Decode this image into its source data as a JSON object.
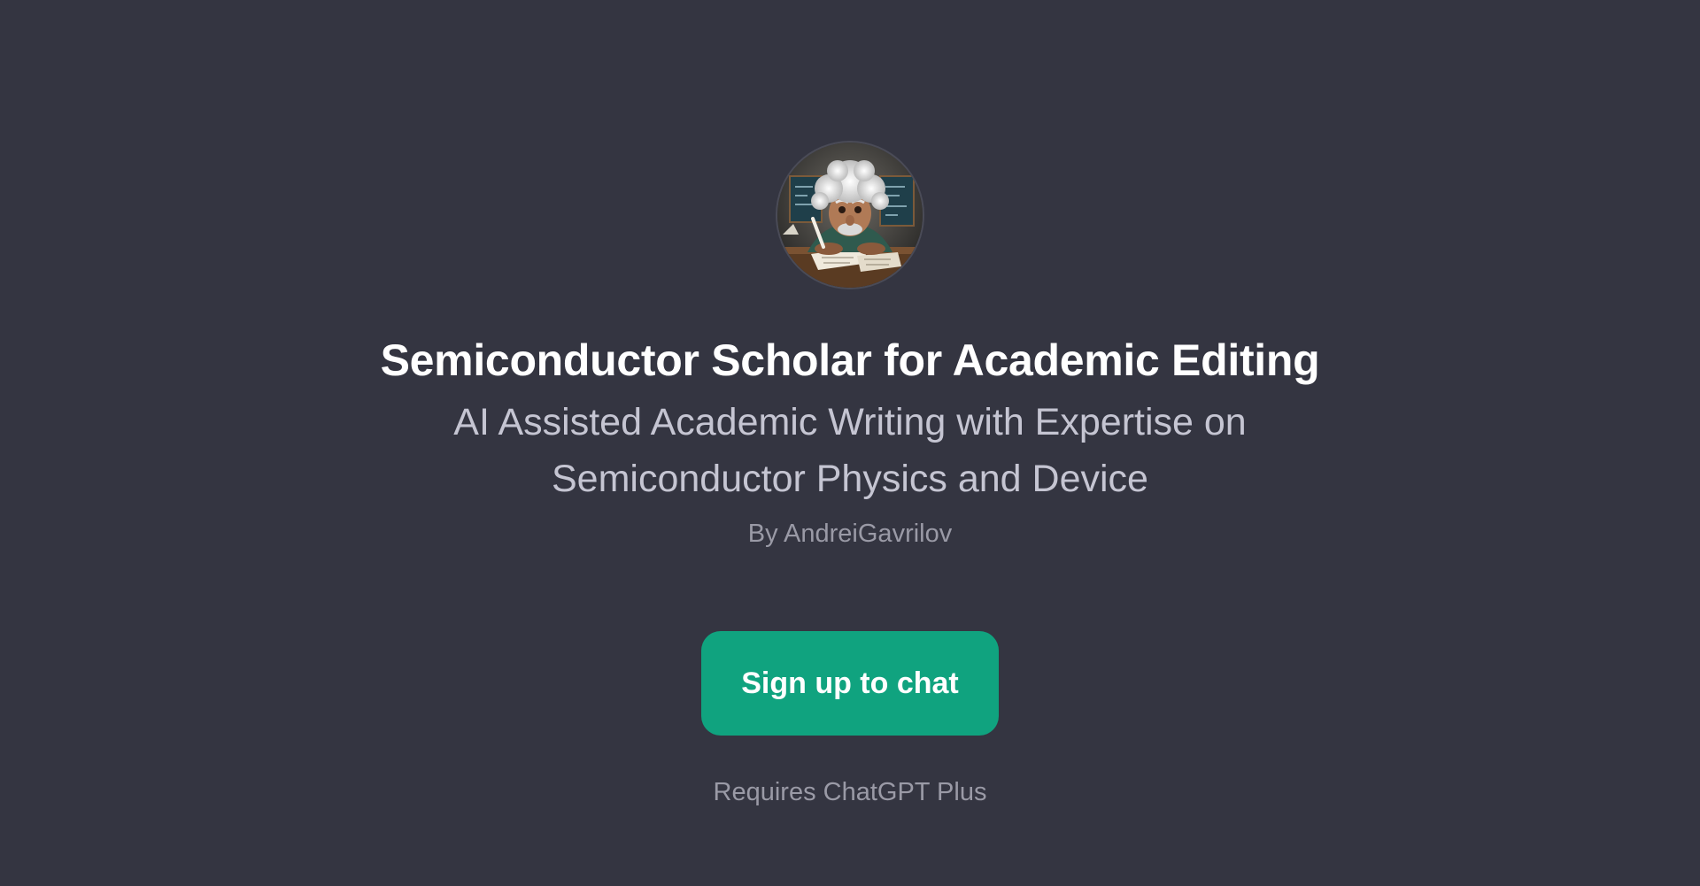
{
  "gpt": {
    "avatar_icon": "scholar-portrait-icon",
    "title": "Semiconductor Scholar for Academic Editing",
    "description": "AI Assisted Academic Writing with Expertise on Semiconductor Physics and Device",
    "author": "By AndreiGavrilov"
  },
  "actions": {
    "signup_label": "Sign up to chat",
    "requirement_note": "Requires ChatGPT Plus"
  },
  "colors": {
    "background": "#343541",
    "accent": "#10a37f",
    "title_text": "#ffffff",
    "subtitle_text": "#c5c5d2",
    "muted_text": "#9a9aa6"
  }
}
